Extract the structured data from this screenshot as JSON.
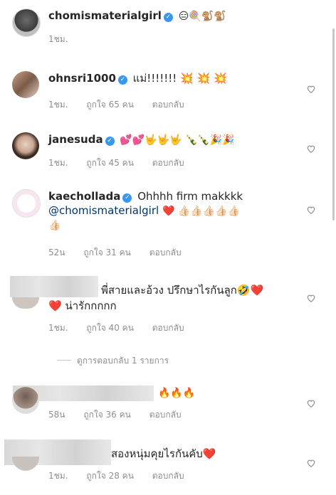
{
  "comments": [
    {
      "username": "chomismaterialgirl",
      "verified": true,
      "text": "😑🍭🐒🐒",
      "time": "1ชม.",
      "likes": "",
      "reply": ""
    },
    {
      "username": "ohnsri1000",
      "verified": true,
      "text": "แม่!!!!!!! 💥 💥 💥",
      "time": "1ชม.",
      "likes": "ถูกใจ 65 คน",
      "reply": "ตอบกลับ"
    },
    {
      "username": "janesuda",
      "verified": true,
      "text": "💕💕🤟🤟🤟 🍾🍾🎉🎉",
      "time": "1ชม.",
      "likes": "ถูกใจ 45 คน",
      "reply": "ตอบกลับ"
    },
    {
      "username": "kaechollada",
      "verified": true,
      "text": "Ohhhh firm makkkk",
      "mention": "@chomismaterialgirl",
      "text2": "❤️ 👍🏻👍🏻👍🏻👍🏻👍🏻",
      "text3": "👍🏻",
      "time": "52น",
      "likes": "ถูกใจ 31 คน",
      "reply": "ตอบกลับ"
    },
    {
      "username": "",
      "verified": false,
      "text": "พี่สายและอ้วง ปรึกษาไรกันลูก🤣❤️",
      "text2": "❤️ น่ารักกกกก",
      "time": "1ชม.",
      "likes": "ถูกใจ 40 คน",
      "reply": "ตอบกลับ"
    },
    {
      "username": "",
      "verified": false,
      "text": "🔥🔥🔥",
      "time": "58น",
      "likes": "ถูกใจ 36 คน",
      "reply": "ตอบกลับ"
    },
    {
      "username": "",
      "verified": false,
      "text": "สองหนุ่มคุยไรกันคับ❤️",
      "time": "1ชม.",
      "likes": "ถูกใจ 28 คน",
      "reply": "ตอบกลับ"
    }
  ],
  "view_replies": "ดูการตอบกลับ 1 รายการ",
  "colors": {
    "verified": "#3897f0",
    "meta": "#8e8e8e",
    "text": "#262626"
  }
}
